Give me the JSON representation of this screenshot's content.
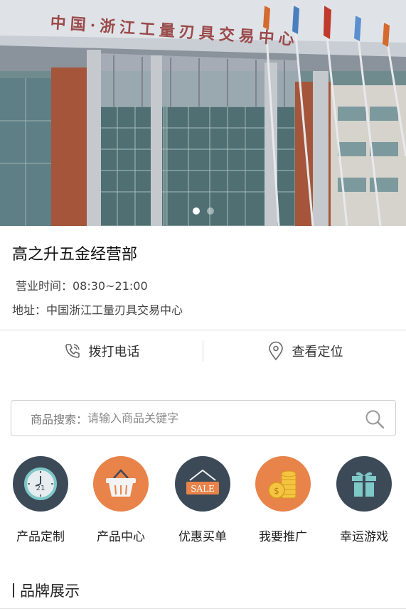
{
  "banner": {
    "sign_text": "中国·浙江工量刃具交易中心",
    "slide_count": 2,
    "active_slide": 1
  },
  "store": {
    "name": "高之升五金经营部",
    "hours": "营业时间：08:30~21:00",
    "address": "地址：中国浙江工量刃具交易中心"
  },
  "actions": {
    "call_label": "拨打电话",
    "locate_label": "查看定位"
  },
  "search": {
    "label": "商品搜索：",
    "placeholder": "请输入商品关键字"
  },
  "categories": [
    {
      "label": "产品定制",
      "icon": "clock-icon",
      "color": "#3c4a58"
    },
    {
      "label": "产品中心",
      "icon": "basket-icon",
      "color": "#e8834a"
    },
    {
      "label": "优惠买单",
      "icon": "sale-tag-icon",
      "color": "#3c4a58"
    },
    {
      "label": "我要推广",
      "icon": "coins-icon",
      "color": "#e8834a"
    },
    {
      "label": "幸运游戏",
      "icon": "gift-icon",
      "color": "#3c4a58"
    }
  ],
  "section": {
    "title": "品牌展示"
  }
}
